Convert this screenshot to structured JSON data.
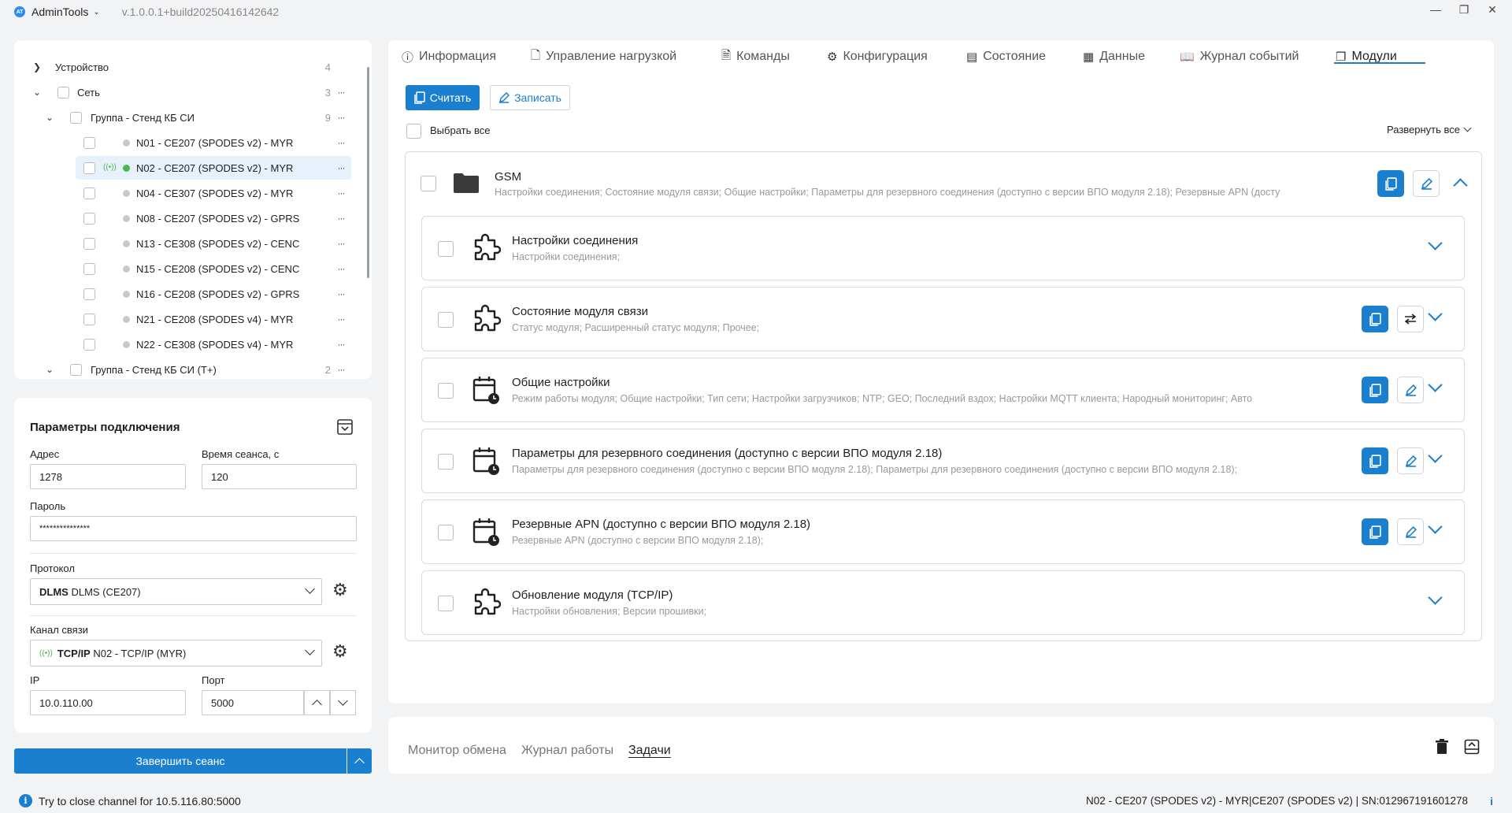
{
  "app": {
    "logo": "AT",
    "name": "AdminTools",
    "version": "v.1.0.0.1+build20250416142642"
  },
  "tree": {
    "rows": [
      {
        "label": "Устройство",
        "count": "4"
      },
      {
        "label": "Сеть",
        "count": "3"
      },
      {
        "label": "Группа - Стенд КБ СИ",
        "count": "9"
      },
      {
        "label": "N01 - CE207 (SPODES v2) - MYR"
      },
      {
        "label": "N02 - CE207 (SPODES v2) - MYR"
      },
      {
        "label": "N04 - CE307 (SPODES v2) - MYR"
      },
      {
        "label": "N08 - CE207 (SPODES v2) - GPRS"
      },
      {
        "label": "N13 - CE308 (SPODES v2) - CENC"
      },
      {
        "label": "N15 - CE208 (SPODES v2) - CENC"
      },
      {
        "label": "N16 - CE208 (SPODES v2) - GPRS"
      },
      {
        "label": "N21 - CE208 (SPODES v4) - MYR"
      },
      {
        "label": "N22 - CE308 (SPODES v4) - MYR"
      },
      {
        "label": "Группа - Стенд КБ СИ (Т+)",
        "count": "2"
      }
    ],
    "dots": "···"
  },
  "conn": {
    "title": "Параметры подключения",
    "address_label": "Адрес",
    "address_value": "1278",
    "session_label": "Время сеанса, с",
    "session_value": "120",
    "password_label": "Пароль",
    "password_value": "***************",
    "protocol_label": "Протокол",
    "protocol_bold": "DLMS",
    "protocol_value": "DLMS (CE207)",
    "channel_label": "Канал связи",
    "channel_bold": "TCP/IP",
    "channel_value": "N02 - TCP/IP (MYR)",
    "ip_label": "IP",
    "ip_value": "10.0.110.00",
    "port_label": "Порт",
    "port_value": "5000",
    "end_session": "Завершить сеанс"
  },
  "tabs": [
    {
      "label": "Информация",
      "icon": "info-icon"
    },
    {
      "label": "Управление нагрузкой",
      "icon": "load-icon"
    },
    {
      "label": "Команды",
      "icon": "commands-icon"
    },
    {
      "label": "Конфигурация",
      "icon": "config-icon"
    },
    {
      "label": "Состояние",
      "icon": "state-icon"
    },
    {
      "label": "Данные",
      "icon": "data-icon"
    },
    {
      "label": "Журнал событий",
      "icon": "journal-icon"
    },
    {
      "label": "Модули",
      "icon": "modules-icon"
    }
  ],
  "toolbar": {
    "read": "Считать",
    "write": "Записать",
    "select_all": "Выбрать все",
    "expand_all": "Развернуть все"
  },
  "gsm": {
    "title": "GSM",
    "subtitle": "Настройки соединения;  Состояние модуля связи;  Общие настройки;  Параметры для резервного соединения (доступно с версии ВПО модуля 2.18);  Резервные APN (досту"
  },
  "modules": [
    {
      "title": "Настройки соединения",
      "subtitle": "Настройки соединения;"
    },
    {
      "title": "Состояние модуля связи",
      "subtitle": "Статус модуля;  Расширенный статус модуля;  Прочее;"
    },
    {
      "title": "Общие настройки",
      "subtitle": "Режим работы модуля;  Общие настройки;  Тип сети;  Настройки загрузчиков;  NTP;  GEO;  Последний вздох;  Настройки MQTT клиента;  Народный мониторинг;  Авто"
    },
    {
      "title": "Параметры для резервного соединения (доступно с версии ВПО модуля 2.18)",
      "subtitle": "Параметры для резервного соединения (доступно с версии ВПО модуля 2.18);  Параметры для резервного соединения (доступно с версии ВПО модуля 2.18);"
    },
    {
      "title": "Резервные APN (доступно с версии ВПО модуля 2.18)",
      "subtitle": "Резервные APN (доступно с версии ВПО модуля 2.18);"
    },
    {
      "title": "Обновление модуля (TCP/IP)",
      "subtitle": "Настройки обновления;  Версии прошивки;"
    }
  ],
  "bottom_tabs": [
    "Монитор обмена",
    "Журнал работы",
    "Задачи"
  ],
  "status": {
    "message": "Try to close channel for 10.5.116.80:5000",
    "device": "N02 - CE207 (SPODES v2) - MYR|CE207 (SPODES v2) | SN:012967191601278",
    "info_glyph": "i"
  },
  "colors": {
    "accent": "#1b7fcf",
    "online": "#4cb84c",
    "offline": "#c6c8cc"
  }
}
